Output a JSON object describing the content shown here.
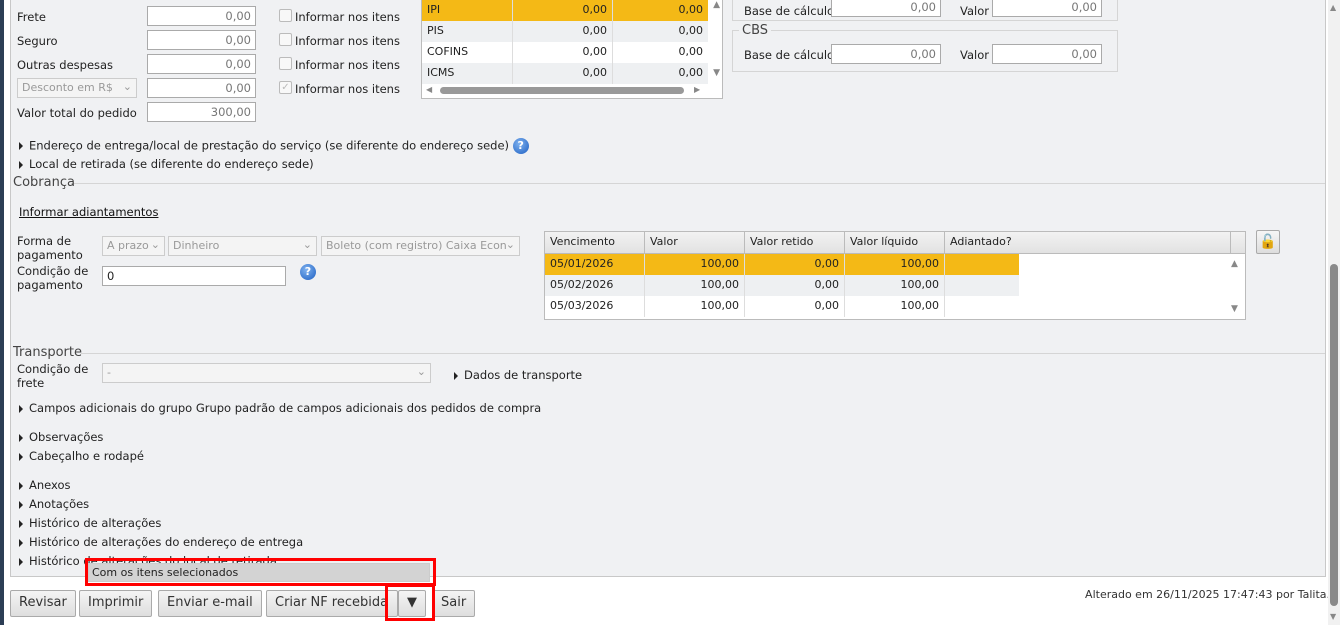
{
  "totals": {
    "rows": [
      {
        "label": "Frete",
        "value": "0,00",
        "check_label": "Informar nos itens",
        "checked": false
      },
      {
        "label": "Seguro",
        "value": "0,00",
        "check_label": "Informar nos itens",
        "checked": false
      },
      {
        "label": "Outras despesas",
        "value": "0,00",
        "check_label": "Informar nos itens",
        "checked": false
      },
      {
        "label": "Desconto em R$",
        "value": "0,00",
        "check_label": "Informar nos itens",
        "checked": true
      }
    ],
    "total_label": "Valor total do pedido",
    "total_value": "300,00"
  },
  "tax_grid": [
    {
      "name": "IPI",
      "a": "0,00",
      "b": "0,00"
    },
    {
      "name": "PIS",
      "a": "0,00",
      "b": "0,00"
    },
    {
      "name": "COFINS",
      "a": "0,00",
      "b": "0,00"
    },
    {
      "name": "ICMS",
      "a": "0,00",
      "b": "0,00"
    }
  ],
  "ibs": {
    "base_label": "Base de cálculo",
    "base_value": "0,00",
    "valor_label": "Valor",
    "valor_value": "0,00"
  },
  "cbs": {
    "title": "CBS",
    "base_label": "Base de cálculo",
    "base_value": "0,00",
    "valor_label": "Valor",
    "valor_value": "0,00"
  },
  "expanders_top": [
    "Endereço de entrega/local de prestação do serviço (se diferente do endereço sede)",
    "Local de retirada (se diferente do endereço sede)"
  ],
  "cobranca": {
    "title": "Cobrança",
    "adiantamentos_link": "Informar adiantamentos",
    "forma_label": "Forma de pagamento",
    "prazo": "A prazo",
    "meio": "Dinheiro",
    "boleto": "Boleto (com registro) Caixa Econ",
    "condicao_label": "Condição de pagamento",
    "condicao_value": "0",
    "columns": [
      "Vencimento",
      "Valor",
      "Valor retido",
      "Valor líquido",
      "Adiantado?"
    ],
    "rows": [
      [
        "05/01/2026",
        "100,00",
        "0,00",
        "100,00",
        ""
      ],
      [
        "05/02/2026",
        "100,00",
        "0,00",
        "100,00",
        ""
      ],
      [
        "05/03/2026",
        "100,00",
        "0,00",
        "100,00",
        ""
      ]
    ]
  },
  "transporte": {
    "title": "Transporte",
    "condicao_label": "Condição de frete",
    "condicao_value": "-",
    "dados_label": "Dados de transporte"
  },
  "expanders": [
    "Campos adicionais do grupo Grupo padrão de campos adicionais dos pedidos de compra",
    "Observações",
    "Cabeçalho e rodapé",
    "Anexos",
    "Anotações",
    "Histórico de alterações",
    "Histórico de alterações do endereço de entrega",
    "Histórico de alterações do local de retirada"
  ],
  "dropdown_menu": [
    "Com os itens selecionados"
  ],
  "buttons": {
    "revisar": "Revisar",
    "imprimir": "Imprimir",
    "email": "Enviar e-mail",
    "criar_nf": "Criar NF recebida",
    "arrow": "▼",
    "sair": "Sair"
  },
  "status": "Alterado em 26/11/2025 17:47:43 por Talita.",
  "colors": {
    "highlight": "#f4b916",
    "annotation": "#ff0000"
  }
}
